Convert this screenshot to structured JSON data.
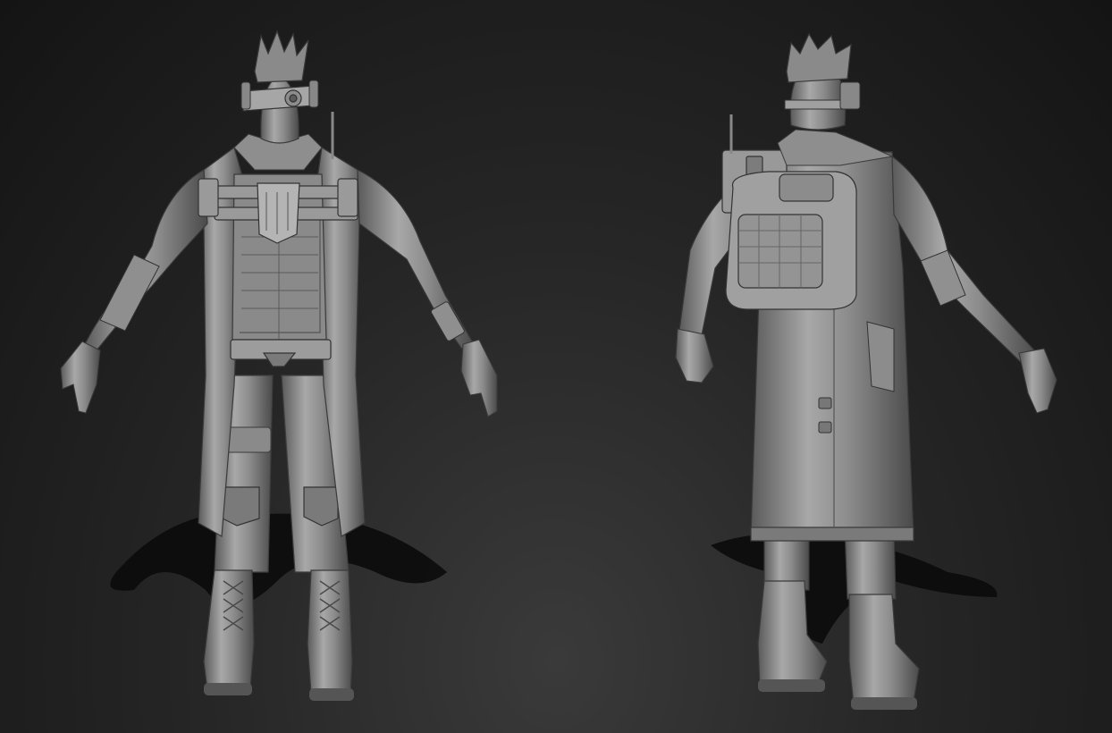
{
  "scene": {
    "background_top": "#141414",
    "background_bottom": "#3a3a3a",
    "sculpt_clay_color": "#8e8e8e",
    "sculpt_highlight": "#b9b9b9",
    "sculpt_shadow": "#4c4c4c",
    "ground_shadow": "#0c0c0c"
  },
  "figures": [
    {
      "view": "front"
    },
    {
      "view": "back"
    }
  ]
}
